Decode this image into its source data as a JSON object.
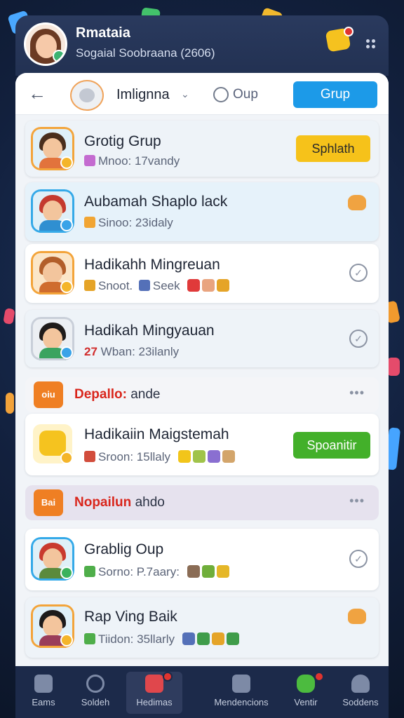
{
  "header": {
    "name": "Rmataia",
    "subtitle": "Sogaial Soobraana (2606)"
  },
  "toolbar": {
    "group_name": "Imlignna",
    "radio_label": "Oup",
    "primary_button": "Grup"
  },
  "rows": [
    {
      "title": "Grotig Grup",
      "meta": "Mnoo: 17vandy",
      "action": "Sphlath"
    },
    {
      "title": "Aubamah Shaplo lack",
      "meta": "Sinoo: 23idaly"
    },
    {
      "title": "Hadikahh Mingreuan",
      "meta": "Snoot.",
      "meta2": "Seek"
    },
    {
      "title": "Hadikah Mingyauan",
      "meta_num": "27",
      "meta": "Wban: 23ilanly"
    },
    {
      "title": "Hadikaiin Maigstemah",
      "meta": "Sroon: 15llaly",
      "action": "Spoanitir"
    },
    {
      "title": "Grablig Oup",
      "meta": "Sorno: P.7aary:"
    },
    {
      "title": "Rap Ving Baik",
      "meta": "Tiidon: 35llarly"
    }
  ],
  "sections": [
    {
      "icon": "oiu",
      "highlight": "Depallo:",
      "rest": "ande"
    },
    {
      "icon": "Bai",
      "highlight": "Nopailun",
      "rest": "ahdo"
    }
  ],
  "nav": [
    {
      "label": "Eams",
      "icon": "home-icon"
    },
    {
      "label": "Soldeh",
      "icon": "clock-icon"
    },
    {
      "label": "Hedimas",
      "icon": "list-icon"
    },
    {
      "label": "Mendencions",
      "icon": "image-icon"
    },
    {
      "label": "Ventir",
      "icon": "frog-icon"
    },
    {
      "label": "Soddens",
      "icon": "user-icon"
    }
  ]
}
